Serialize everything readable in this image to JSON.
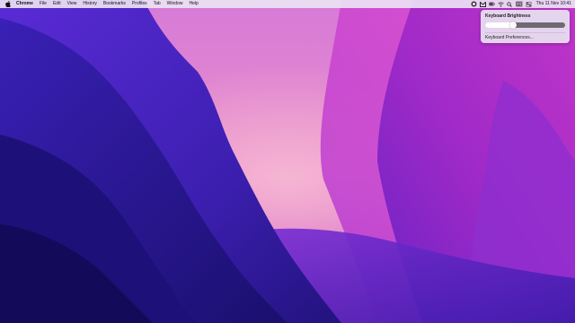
{
  "menubar": {
    "apple_icon": "apple-logo-icon",
    "app_name": "Chrome",
    "items": [
      "File",
      "Edit",
      "View",
      "History",
      "Bookmarks",
      "Profiles",
      "Tab",
      "Window",
      "Help"
    ],
    "status_icons": [
      "extension-icon",
      "gmail-icon",
      "battery-icon",
      "wifi-icon",
      "search-icon",
      "keyboard-brightness-icon",
      "control-center-icon"
    ],
    "clock": "Thu 11 Nov  10:41"
  },
  "keyboard_popup": {
    "title": "Keyboard Brightness",
    "brightness_level": 0.35,
    "preferences_label": "Keyboard Preferences..."
  },
  "colors": {
    "wallpaper_deep": "#1a0f6e",
    "wallpaper_mid": "#5a2bd6",
    "wallpaper_pink": "#e04ad0",
    "wallpaper_glow": "#f7b9d4"
  }
}
